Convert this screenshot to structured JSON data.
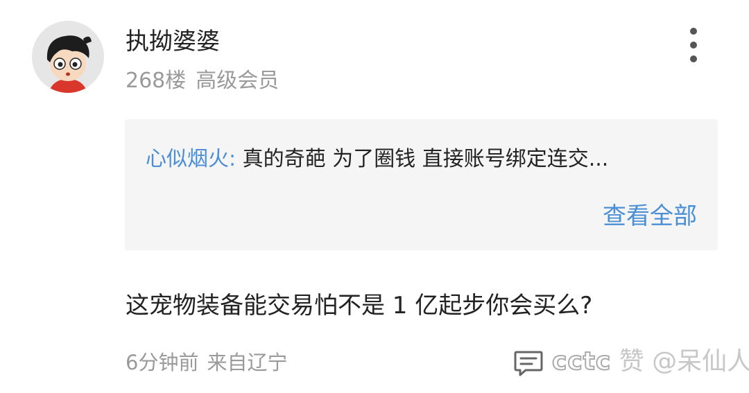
{
  "post": {
    "username": "执拗婆婆",
    "floor": "268楼",
    "member_level": "高级会员",
    "reply_preview": {
      "author": "心似烟火:",
      "text": "真的奇葩  为了圈钱   直接账号绑定连交...",
      "view_all_label": "查看全部"
    },
    "content": "这宠物装备能交易怕不是 1 亿起步你会买么?",
    "time": "6分钟前",
    "location": "来自辽宁"
  },
  "icons": {
    "more": "more-vertical-icon",
    "comment": "comment-icon"
  },
  "watermark": {
    "brand": "cctc",
    "text": "赞 @呆仙人"
  },
  "colors": {
    "link_blue": "#4a8fd6",
    "text_primary": "#222222",
    "text_secondary": "#9a9a9a",
    "reply_background": "#f5f5f5"
  }
}
